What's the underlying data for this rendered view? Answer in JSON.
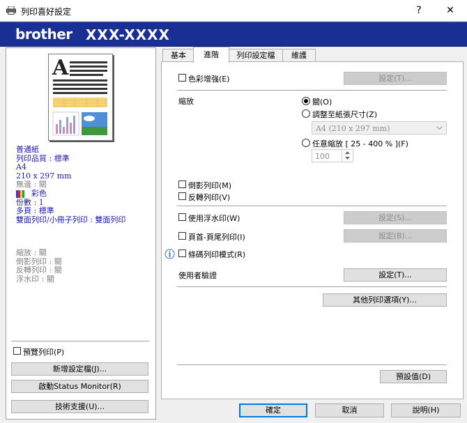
{
  "window": {
    "title": "列印喜好設定",
    "help_glyph": "?",
    "close_glyph": "✕",
    "brand": "brother",
    "model": "XXX-XXXX"
  },
  "tabs": [
    "基本",
    "進階",
    "列印設定檔",
    "維護"
  ],
  "active_tab": "進階",
  "summary": {
    "lines": [
      "普通紙",
      "列印品質 : 標準",
      "A4",
      "210 x 297 mm"
    ],
    "borderless": "無邊 : 關",
    "color": "彩色",
    "lines2": [
      "份數 : 1",
      "多頁 : 標準",
      "雙面列印/小冊子列印 : 雙面列印"
    ],
    "grey": [
      "縮放 : 關",
      "倒影列印 : 關",
      "反轉列印 : 關",
      "浮水印 : 關"
    ]
  },
  "left": {
    "preview_checkbox": "預覽列印(P)",
    "add_profile": "新增設定檔(J)...",
    "status_monitor": "啟動Status Monitor(R)",
    "support": "技術支援(U)..."
  },
  "advanced": {
    "color_enhance": "色彩增強(E)",
    "settings_t": "設定(T)...",
    "scaling_label": "縮放",
    "scale_off": "關(O)",
    "scale_fit": "調整至紙張尺寸(Z)",
    "paper_select": "A4 (210 x 297 mm)",
    "scale_free": "任意縮放 [ 25 - 400 % ](F)",
    "scale_value": "100",
    "mirror": "倒影列印(M)",
    "reverse": "反轉列印(V)",
    "watermark": "使用浮水印(W)",
    "settings_s": "設定(S)...",
    "header_footer": "頁首-頁尾列印(I)",
    "settings_b": "設定(B)...",
    "barcode": "條碼列印模式(R)",
    "user_auth": "使用者驗證",
    "settings_t2": "設定(T)...",
    "other_options": "其他列印選項(Y)...",
    "default": "預設值(D)"
  },
  "footer": {
    "ok": "確定",
    "cancel": "取消",
    "help": "說明(H)"
  },
  "colors": {
    "banner": "#1a2f94",
    "summary_text": "#1a1ab0",
    "focus": "#0078d7"
  }
}
